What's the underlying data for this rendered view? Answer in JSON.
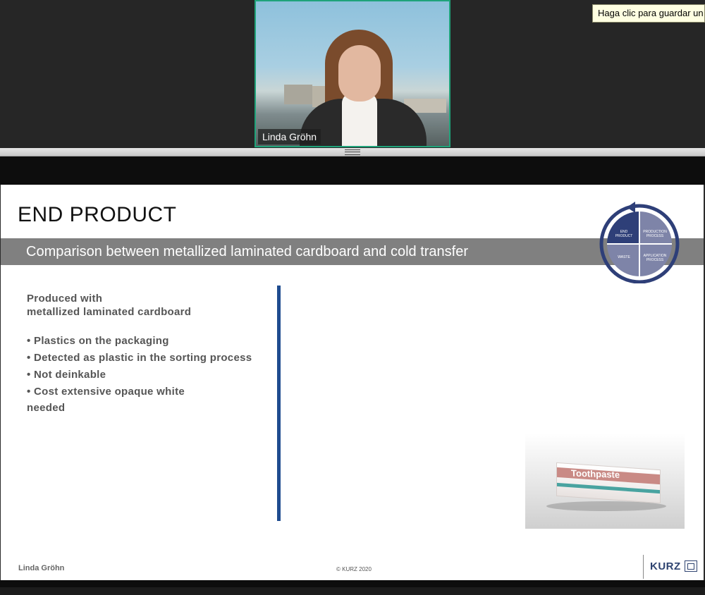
{
  "participant": {
    "name": "Linda Gröhn"
  },
  "tooltip": {
    "text": "Haga clic para guardar un"
  },
  "slide": {
    "title": "END PRODUCT",
    "subtitle": "Comparison between metallized laminated cardboard and cold transfer",
    "cycle_labels": {
      "top_left": [
        "END",
        "PRODUCT"
      ],
      "top_right": [
        "PRODUCTION",
        "PROCESS"
      ],
      "bottom_left": [
        "WASTE"
      ],
      "bottom_right": [
        "APPLICATION",
        "PROCESS"
      ]
    },
    "left_column": {
      "heading_line1": "Produced with",
      "heading_line2": "metallized laminated cardboard",
      "bullets": [
        "• Plastics on the packaging",
        "• Detected as plastic in the sorting process",
        "• Not deinkable",
        "• Cost extensive opaque white"
      ],
      "continuation": "needed"
    },
    "product_label": "Toothpaste",
    "footer": {
      "presenter": "Linda Gröhn",
      "copyright": "© KURZ 2020",
      "logo_text": "KURZ"
    }
  },
  "colors": {
    "accent_divider": "#1f4c8f",
    "cycle_dark": "#2e3f78",
    "cycle_light": "#7e84a8",
    "speaking_border": "#1fa37a"
  }
}
